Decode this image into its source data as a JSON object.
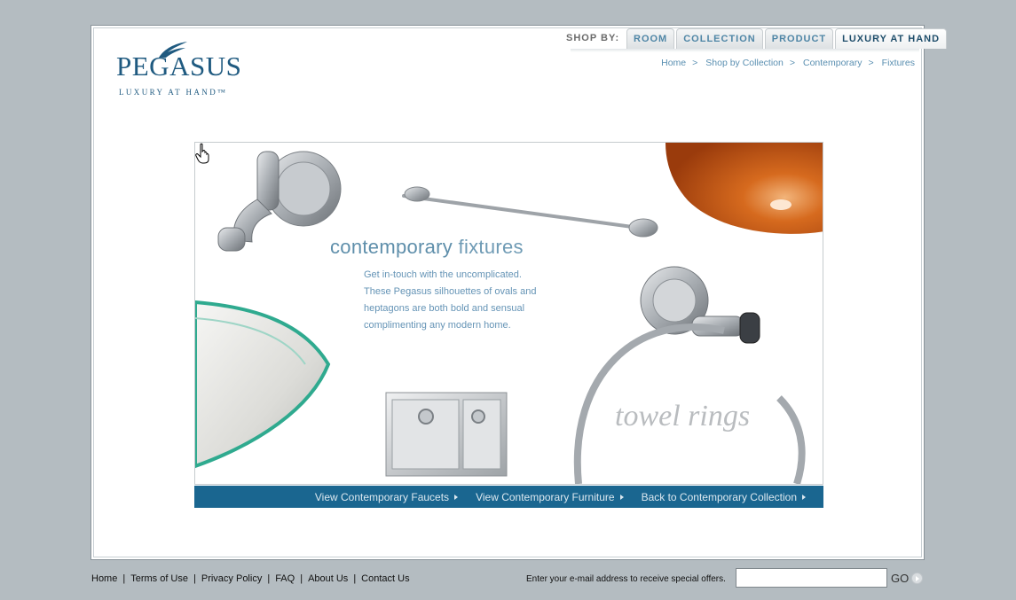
{
  "brand": {
    "name": "PEGASUS",
    "tagline": "LUXURY AT HAND™"
  },
  "shop_by": {
    "label": "SHOP BY:",
    "tabs": [
      {
        "label": "ROOM",
        "active": false
      },
      {
        "label": "COLLECTION",
        "active": false
      },
      {
        "label": "PRODUCT",
        "active": false
      },
      {
        "label": "LUXURY AT HAND",
        "active": true
      }
    ]
  },
  "breadcrumb": {
    "items": [
      "Home",
      "Shop by Collection",
      "Contemporary",
      "Fixtures"
    ],
    "separator": ">"
  },
  "hero": {
    "title_bold": "contemporary",
    "title_light": "fixtures",
    "description": "Get in-touch with the uncomplicated. These Pegasus silhouettes of ovals and heptagons are both bold and sensual complimenting any modern home.",
    "hover_label": "towel rings",
    "cursor_icon": "hand-pointer-icon"
  },
  "nav_links": [
    "View Contemporary Faucets",
    "View Contemporary Furniture",
    "Back to Contemporary Collection"
  ],
  "footer": {
    "links": [
      "Home",
      "Terms of Use",
      "Privacy Policy",
      "FAQ",
      "About Us",
      "Contact Us"
    ],
    "email_label": "Enter your e-mail address to receive special offers.",
    "email_value": "",
    "go_label": "GO"
  },
  "colors": {
    "background": "#b4bcc1",
    "brand_blue": "#1f5a80",
    "nav_bar": "#1a6690",
    "link_blue": "#5a8fb1"
  }
}
